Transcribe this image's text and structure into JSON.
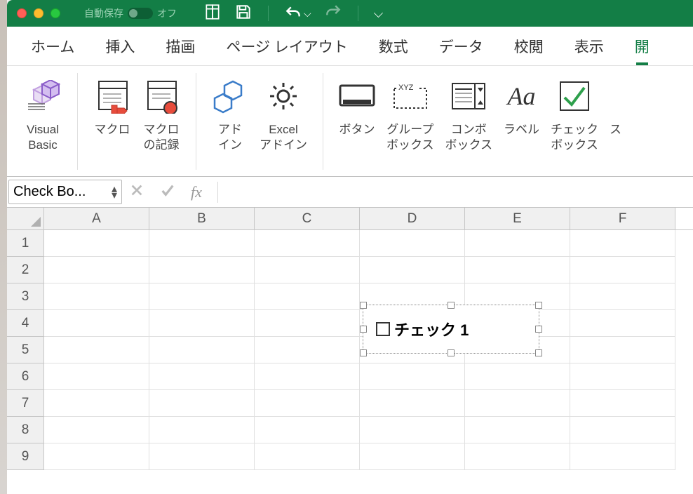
{
  "titlebar": {
    "autosave_label": "自動保存",
    "autosave_state": "オフ"
  },
  "tabs": [
    {
      "label": "ホーム"
    },
    {
      "label": "挿入"
    },
    {
      "label": "描画"
    },
    {
      "label": "ページ レイアウト"
    },
    {
      "label": "数式"
    },
    {
      "label": "データ"
    },
    {
      "label": "校閲"
    },
    {
      "label": "表示"
    },
    {
      "label": "開"
    }
  ],
  "ribbon": {
    "vb": "Visual\nBasic",
    "macro": "マクロ",
    "record": "マクロ\nの記録",
    "addin": "アド\nイン",
    "exceladdin": "Excel\nアドイン",
    "button": "ボタン",
    "groupbox": "グループ\nボックス",
    "combo": "コンボ\nボックス",
    "label": "ラベル",
    "checkbox": "チェック\nボックス",
    "scroll": "ス"
  },
  "namebox": "Check Bo...",
  "fx": "fx",
  "columns": [
    "A",
    "B",
    "C",
    "D",
    "E",
    "F"
  ],
  "rows": [
    "1",
    "2",
    "3",
    "4",
    "5",
    "6",
    "7",
    "8",
    "9"
  ],
  "control": {
    "label": "チェック 1"
  }
}
